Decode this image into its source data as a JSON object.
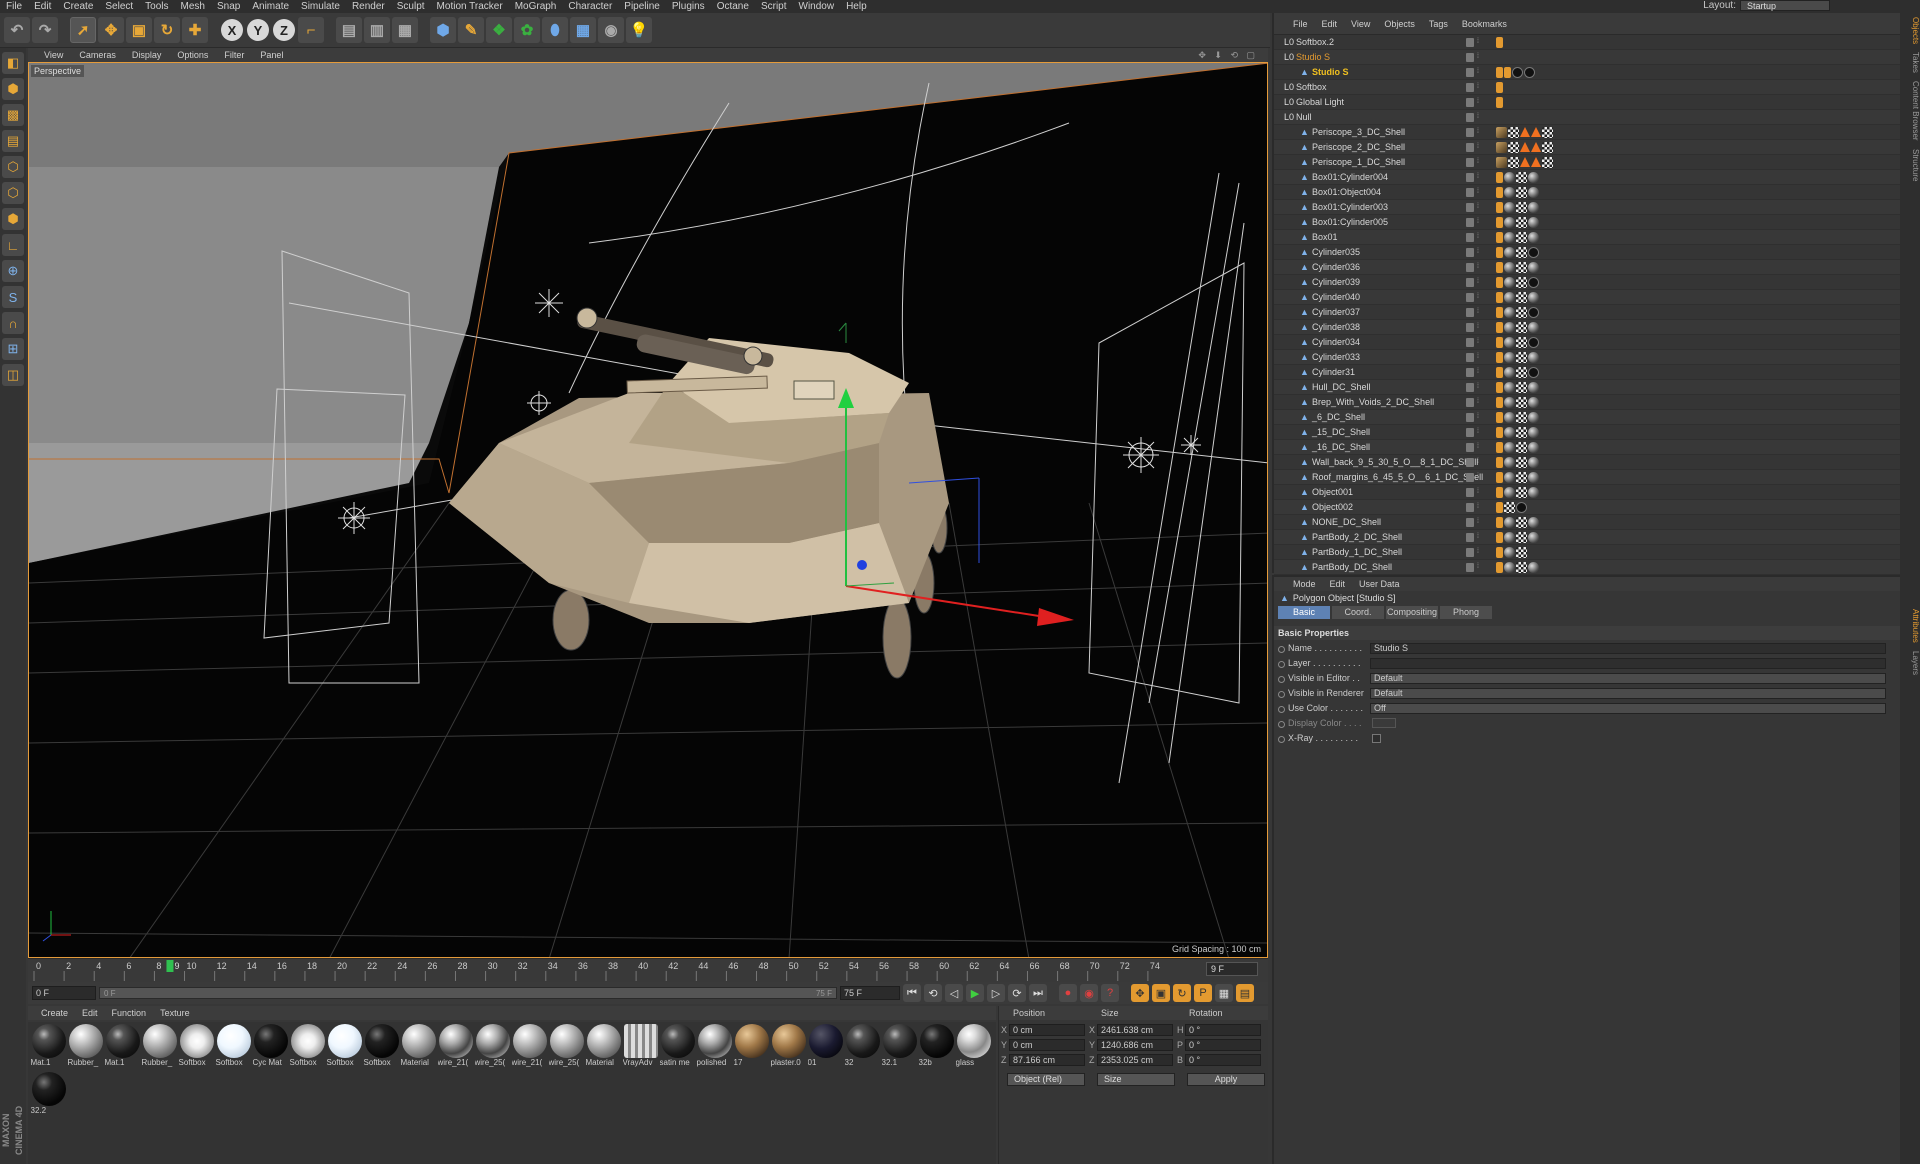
{
  "menubar": {
    "items": [
      "File",
      "Edit",
      "Create",
      "Select",
      "Tools",
      "Mesh",
      "Snap",
      "Animate",
      "Simulate",
      "Render",
      "Sculpt",
      "Motion Tracker",
      "MoGraph",
      "Character",
      "Pipeline",
      "Plugins",
      "Octane",
      "Script",
      "Window",
      "Help"
    ],
    "layout_label": "Layout:",
    "layout_value": "Startup"
  },
  "toolbar": {
    "axis_x": "X",
    "axis_y": "Y",
    "axis_z": "Z"
  },
  "viewport": {
    "menu": [
      "View",
      "Cameras",
      "Display",
      "Options",
      "Filter",
      "Panel"
    ],
    "label": "Perspective",
    "grid_spacing": "Grid Spacing : 100 cm"
  },
  "timeline": {
    "ticks": [
      "0",
      "2",
      "4",
      "6",
      "8",
      "10",
      "12",
      "14",
      "16",
      "18",
      "20",
      "22",
      "24",
      "26",
      "28",
      "30",
      "32",
      "34",
      "36",
      "38",
      "40",
      "42",
      "44",
      "46",
      "48",
      "50",
      "52",
      "54",
      "56",
      "58",
      "60",
      "62",
      "64",
      "66",
      "68",
      "70",
      "72",
      "74"
    ],
    "current_frame_marker": "9",
    "frame_field": "9 F"
  },
  "transport": {
    "start": "0 F",
    "slider_left": "0 F",
    "slider_right": "75 F",
    "end": "75 F"
  },
  "materials": {
    "menu": [
      "Create",
      "Edit",
      "Function",
      "Texture"
    ],
    "items": [
      {
        "label": "Mat.1",
        "color": "dark"
      },
      {
        "label": "Rubber_",
        "color": "silver"
      },
      {
        "label": "Mat.1",
        "color": "dark"
      },
      {
        "label": "Rubber_",
        "color": "silver"
      },
      {
        "label": "Softbox",
        "color": "glow"
      },
      {
        "label": "Softbox",
        "color": "white"
      },
      {
        "label": "Cyc Mat",
        "color": "black"
      },
      {
        "label": "Softbox",
        "color": "glow"
      },
      {
        "label": "Softbox",
        "color": "white"
      },
      {
        "label": "Softbox",
        "color": "black"
      },
      {
        "label": "Material",
        "color": "silver"
      },
      {
        "label": "wire_21(",
        "color": "chrome"
      },
      {
        "label": "wire_25(",
        "color": "chrome"
      },
      {
        "label": "wire_21(",
        "color": "silver"
      },
      {
        "label": "wire_25(",
        "color": "silver"
      },
      {
        "label": "Material",
        "color": "silver"
      },
      {
        "label": "VrayAdv",
        "color": "stripes"
      },
      {
        "label": "satin me",
        "color": "dark"
      },
      {
        "label": "polished",
        "color": "chrome"
      },
      {
        "label": "17",
        "color": "wood"
      },
      {
        "label": "plaster.0",
        "color": "wood"
      },
      {
        "label": "01",
        "color": "navy"
      },
      {
        "label": "32",
        "color": "dark"
      },
      {
        "label": "32.1",
        "color": "dark"
      },
      {
        "label": "32b",
        "color": "black"
      },
      {
        "label": "glass",
        "color": "glass"
      },
      {
        "label": "32.2",
        "color": "black"
      }
    ]
  },
  "coords": {
    "headers": [
      "Position",
      "Size",
      "Rotation"
    ],
    "rows": [
      {
        "a": "X",
        "pos": "0 cm",
        "s": "X",
        "size": "2461.638 cm",
        "r": "H",
        "rot": "0 °"
      },
      {
        "a": "Y",
        "pos": "0 cm",
        "s": "Y",
        "size": "1240.686 cm",
        "r": "P",
        "rot": "0 °"
      },
      {
        "a": "Z",
        "pos": "87.166 cm",
        "s": "Z",
        "size": "2353.025 cm",
        "r": "B",
        "rot": "0 °"
      }
    ],
    "mode": "Object (Rel)",
    "size_mode": "Size",
    "apply": "Apply"
  },
  "objects": {
    "menu": [
      "File",
      "Edit",
      "View",
      "Objects",
      "Tags",
      "Bookmarks"
    ],
    "rows": [
      {
        "name": "Softbox.2",
        "indent": 0,
        "color": "#d8d8d8",
        "tags": [
          "ico"
        ]
      },
      {
        "name": "Studio S",
        "indent": 0,
        "color": "#e39a30",
        "tags": []
      },
      {
        "name": "Studio S",
        "indent": 1,
        "color": "#f0c020",
        "tags": [
          "ico",
          "ico",
          "blk",
          "blk"
        ]
      },
      {
        "name": "Softbox",
        "indent": 0,
        "color": "#d8d8d8",
        "tags": [
          "ico"
        ]
      },
      {
        "name": "Global Light",
        "indent": 0,
        "color": "#d8d8d8",
        "tags": [
          "ico"
        ]
      },
      {
        "name": "Null",
        "indent": 0,
        "color": "#d8d8d8",
        "tags": []
      },
      {
        "name": "Periscope_3_DC_Shell",
        "indent": 1,
        "color": "#d8d8d8",
        "tags": [
          "tex",
          "chk",
          "tri",
          "tri",
          "chk"
        ]
      },
      {
        "name": "Periscope_2_DC_Shell",
        "indent": 1,
        "color": "#d8d8d8",
        "tags": [
          "tex",
          "chk",
          "tri",
          "tri",
          "chk"
        ]
      },
      {
        "name": "Periscope_1_DC_Shell",
        "indent": 1,
        "color": "#d8d8d8",
        "tags": [
          "tex",
          "chk",
          "tri",
          "tri",
          "chk"
        ]
      },
      {
        "name": "Box01:Cylinder004",
        "indent": 1,
        "color": "#d8d8d8",
        "tags": [
          "ico",
          "sph",
          "chk",
          "sph"
        ]
      },
      {
        "name": "Box01:Object004",
        "indent": 1,
        "color": "#d8d8d8",
        "tags": [
          "ico",
          "sph",
          "chk",
          "sph"
        ]
      },
      {
        "name": "Box01:Cylinder003",
        "indent": 1,
        "color": "#d8d8d8",
        "tags": [
          "ico",
          "sph",
          "chk",
          "sph"
        ]
      },
      {
        "name": "Box01:Cylinder005",
        "indent": 1,
        "color": "#d8d8d8",
        "tags": [
          "ico",
          "sph",
          "chk",
          "sph"
        ]
      },
      {
        "name": "Box01",
        "indent": 1,
        "color": "#d8d8d8",
        "tags": [
          "ico",
          "sph",
          "chk",
          "sph"
        ]
      },
      {
        "name": "Cylinder035",
        "indent": 1,
        "color": "#d8d8d8",
        "tags": [
          "ico",
          "sph",
          "chk",
          "blk"
        ]
      },
      {
        "name": "Cylinder036",
        "indent": 1,
        "color": "#d8d8d8",
        "tags": [
          "ico",
          "sph",
          "chk",
          "sph"
        ]
      },
      {
        "name": "Cylinder039",
        "indent": 1,
        "color": "#d8d8d8",
        "tags": [
          "ico",
          "sph",
          "chk",
          "blk"
        ]
      },
      {
        "name": "Cylinder040",
        "indent": 1,
        "color": "#d8d8d8",
        "tags": [
          "ico",
          "sph",
          "chk",
          "sph"
        ]
      },
      {
        "name": "Cylinder037",
        "indent": 1,
        "color": "#d8d8d8",
        "tags": [
          "ico",
          "sph",
          "chk",
          "blk"
        ]
      },
      {
        "name": "Cylinder038",
        "indent": 1,
        "color": "#d8d8d8",
        "tags": [
          "ico",
          "sph",
          "chk",
          "sph"
        ]
      },
      {
        "name": "Cylinder034",
        "indent": 1,
        "color": "#d8d8d8",
        "tags": [
          "ico",
          "sph",
          "chk",
          "blk"
        ]
      },
      {
        "name": "Cylinder033",
        "indent": 1,
        "color": "#d8d8d8",
        "tags": [
          "ico",
          "sph",
          "chk",
          "sph"
        ]
      },
      {
        "name": "Cylinder31",
        "indent": 1,
        "color": "#d8d8d8",
        "tags": [
          "ico",
          "sph",
          "chk",
          "blk"
        ]
      },
      {
        "name": "Hull_DC_Shell",
        "indent": 1,
        "color": "#d8d8d8",
        "tags": [
          "ico",
          "sph",
          "chk",
          "sph"
        ]
      },
      {
        "name": "Brep_With_Voids_2_DC_Shell",
        "indent": 1,
        "color": "#d8d8d8",
        "tags": [
          "ico",
          "sph",
          "chk",
          "sph"
        ]
      },
      {
        "name": "_6_DC_Shell",
        "indent": 1,
        "color": "#d8d8d8",
        "tags": [
          "ico",
          "sph",
          "chk",
          "sph"
        ]
      },
      {
        "name": "_15_DC_Shell",
        "indent": 1,
        "color": "#d8d8d8",
        "tags": [
          "ico",
          "sph",
          "chk",
          "sph"
        ]
      },
      {
        "name": "_16_DC_Shell",
        "indent": 1,
        "color": "#d8d8d8",
        "tags": [
          "ico",
          "sph",
          "chk",
          "sph"
        ]
      },
      {
        "name": "Wall_back_9_5_30_5_O__8_1_DC_Shell",
        "indent": 1,
        "color": "#d8d8d8",
        "tags": [
          "ico",
          "sph",
          "chk",
          "sph"
        ]
      },
      {
        "name": "Roof_margins_6_45_5_O__6_1_DC_Shell",
        "indent": 1,
        "color": "#d8d8d8",
        "tags": [
          "ico",
          "sph",
          "chk",
          "sph"
        ]
      },
      {
        "name": "Object001",
        "indent": 1,
        "color": "#d8d8d8",
        "tags": [
          "ico",
          "sph",
          "chk",
          "sph"
        ]
      },
      {
        "name": "Object002",
        "indent": 1,
        "color": "#d8d8d8",
        "tags": [
          "ico",
          "chk",
          "blk"
        ]
      },
      {
        "name": "NONE_DC_Shell",
        "indent": 1,
        "color": "#d8d8d8",
        "tags": [
          "ico",
          "sph",
          "chk",
          "sph"
        ]
      },
      {
        "name": "PartBody_2_DC_Shell",
        "indent": 1,
        "color": "#d8d8d8",
        "tags": [
          "ico",
          "sph",
          "chk",
          "sph"
        ]
      },
      {
        "name": "PartBody_1_DC_Shell",
        "indent": 1,
        "color": "#d8d8d8",
        "tags": [
          "ico",
          "sph",
          "chk"
        ]
      },
      {
        "name": "PartBody_DC_Shell",
        "indent": 1,
        "color": "#d8d8d8",
        "tags": [
          "ico",
          "sph",
          "chk",
          "sph"
        ]
      }
    ]
  },
  "attributes": {
    "menu": [
      "Mode",
      "Edit",
      "User Data"
    ],
    "title": "Polygon Object [Studio S]",
    "tabs": [
      "Basic",
      "Coord.",
      "Compositing",
      "Phong"
    ],
    "section": "Basic Properties",
    "props": [
      {
        "label": "Name . . . . . . . . . .",
        "value": "Studio S",
        "kind": "text"
      },
      {
        "label": "Layer . . . . . . . . . .",
        "value": "",
        "kind": "text"
      },
      {
        "label": "Visible in Editor . .",
        "value": "Default",
        "kind": "dd"
      },
      {
        "label": "Visible in Renderer",
        "value": "Default",
        "kind": "dd"
      },
      {
        "label": "Use Color . . . . . . .",
        "value": "Off",
        "kind": "dd"
      },
      {
        "label": "Display Color . . . .",
        "value": "",
        "kind": "dim"
      },
      {
        "label": "X-Ray . . . . . . . . .",
        "value": "",
        "kind": "check"
      }
    ]
  },
  "right_tabs": [
    "Objects",
    "Takes",
    "Content Browser",
    "Structure",
    "Attributes",
    "Layers"
  ],
  "brand": "MAXON CINEMA 4D"
}
